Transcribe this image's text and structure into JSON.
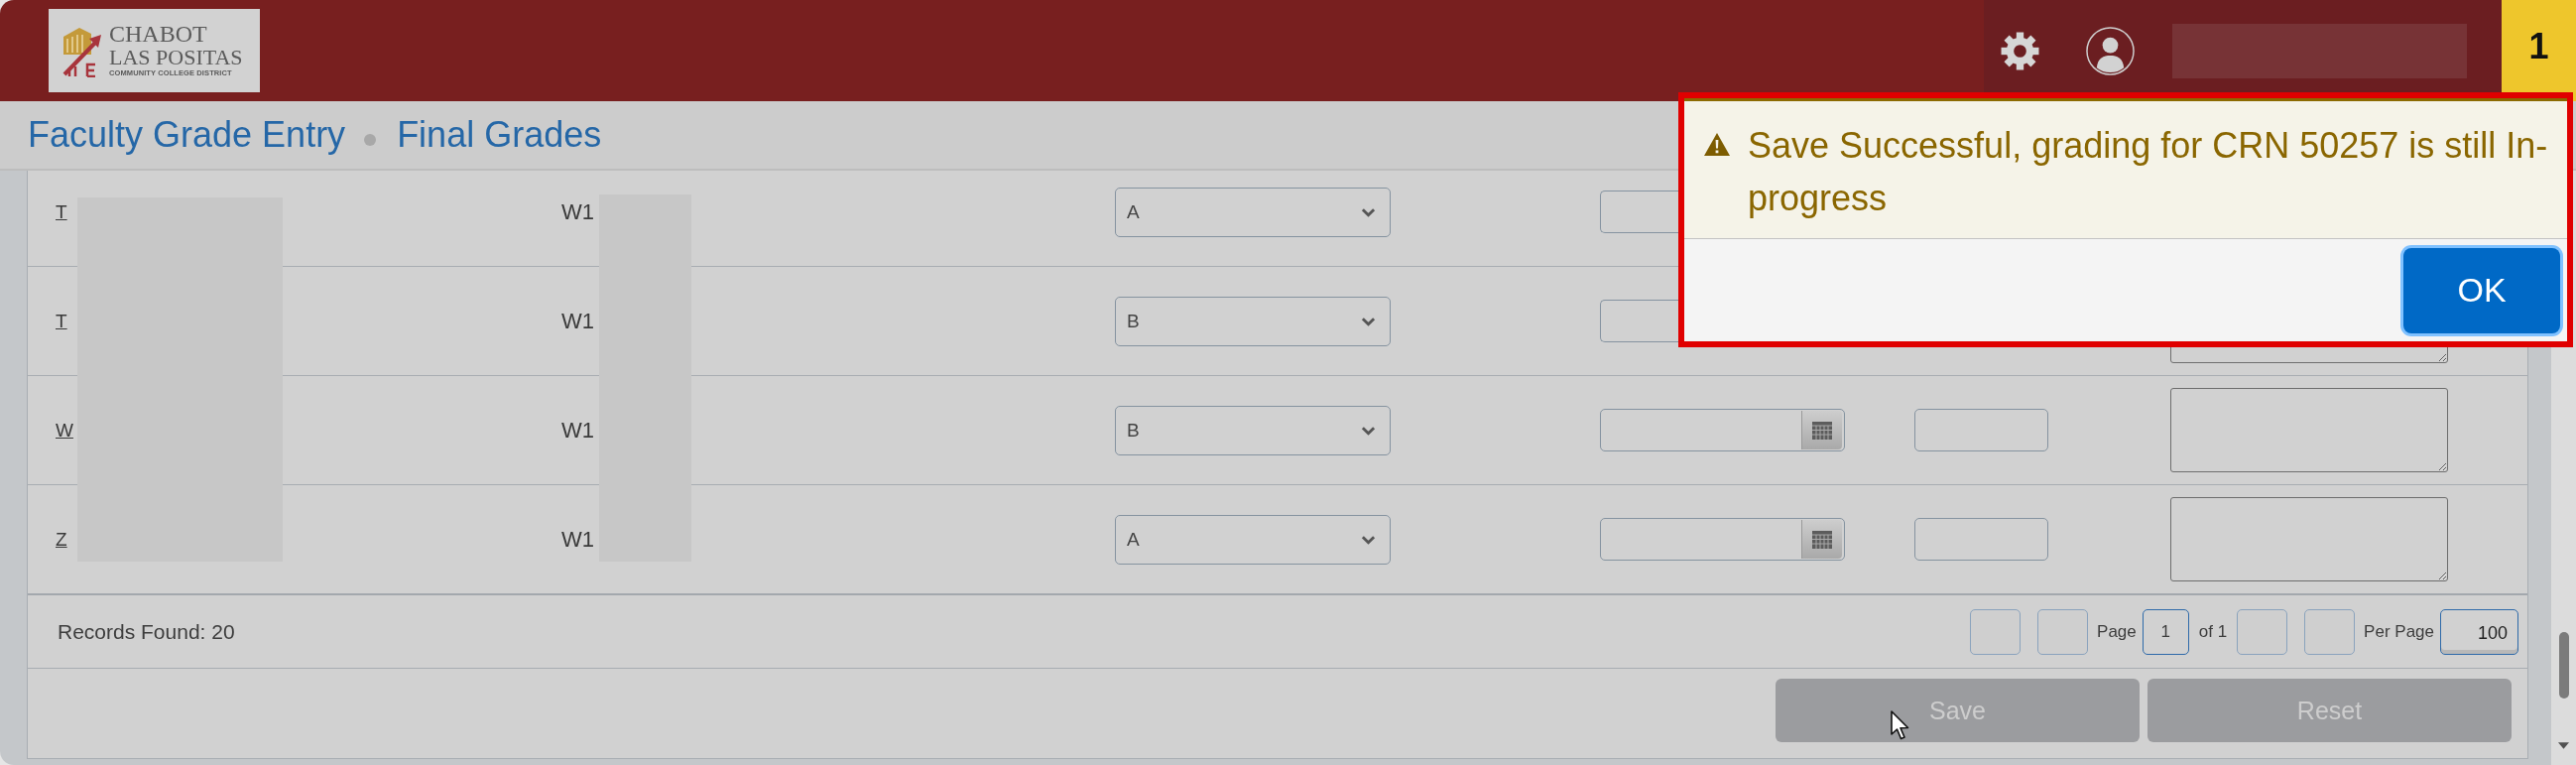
{
  "header": {
    "logo_lines": [
      "CHABOT",
      "LAS POSITAS",
      "COMMUNITY COLLEGE DISTRICT"
    ],
    "notification_count": "1"
  },
  "breadcrumb": [
    "Faculty Grade Entry",
    "Final Grades"
  ],
  "table": {
    "rows": [
      {
        "name": "T",
        "id": "W1",
        "grade": "A",
        "controls": [
          {
            "kind": "date-edge"
          }
        ]
      },
      {
        "name": "T",
        "id": "W1",
        "grade": "B",
        "controls": [
          {
            "kind": "date-edge"
          },
          {
            "kind": "comment-edge"
          }
        ]
      },
      {
        "name": "W",
        "id": "W1",
        "grade": "B",
        "controls": [
          {
            "kind": "date"
          },
          {
            "kind": "input"
          },
          {
            "kind": "comment"
          }
        ]
      },
      {
        "name": "Z",
        "id": "W1",
        "grade": "A",
        "controls": [
          {
            "kind": "date"
          },
          {
            "kind": "input"
          },
          {
            "kind": "comment"
          }
        ]
      }
    ]
  },
  "footer": {
    "records_found": "Records Found: 20",
    "pagination": {
      "page_label": "Page",
      "page": "1",
      "of_label": "of 1",
      "per_page_label": "Per Page",
      "per_page": "100"
    },
    "buttons": [
      {
        "label": "Save",
        "disabled": true
      },
      {
        "label": "Reset",
        "disabled": true
      }
    ]
  },
  "notification": {
    "kind": "warning",
    "message": "Save Successful, grading for CRN 50257 is still In-progress",
    "button": "OK"
  }
}
